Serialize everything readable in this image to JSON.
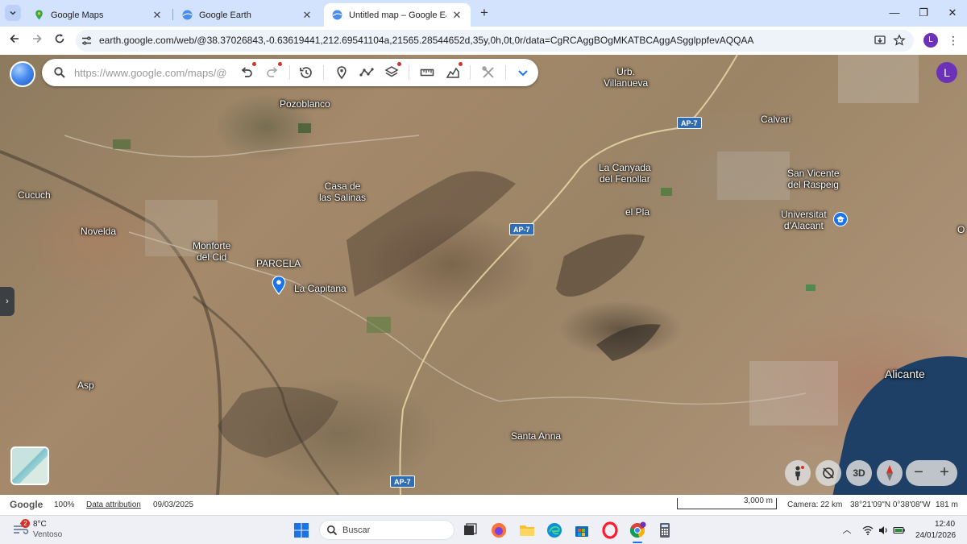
{
  "browser": {
    "tabs": [
      {
        "label": "Google Maps",
        "icon": "maps-pin-icon"
      },
      {
        "label": "Google Earth",
        "icon": "earth-icon"
      },
      {
        "label": "Untitled map – Google Earth",
        "icon": "earth-icon",
        "active": true
      }
    ],
    "url": "earth.google.com/web/@38.37026843,-0.63619441,212.69541104a,21565.28544652d,35y,0h,0t,0r/data=CgRCAggBOgMKATBCAggASgglppfevAQQAA",
    "profile_initial": "L"
  },
  "earth": {
    "search_placeholder": "https://www.google.com/maps/@",
    "user_initial": "L",
    "toolbar_icons": [
      "undo-icon",
      "redo-icon",
      "history-icon",
      "place-pin-icon",
      "path-icon",
      "layers-icon",
      "ruler-icon",
      "chart-icon",
      "tools-icon",
      "chevron-down-icon"
    ],
    "controls": {
      "three_d_label": "3D"
    },
    "places": {
      "pozoblanco": "Pozoblanco",
      "urb_villanueva_1": "Urb.",
      "urb_villanueva_2": "Villanueva",
      "calvari": "Calvari",
      "cucuch": "Cucuch",
      "casa_salinas_1": "Casa de",
      "casa_salinas_2": "las Salinas",
      "la_canyada_1": "La Canyada",
      "la_canyada_2": "del Fenollar",
      "san_vicente_1": "San Vicente",
      "san_vicente_2": "del Raspeig",
      "novelda": "Novelda",
      "el_pla": "el Pla",
      "universitat_1": "Universitat",
      "universitat_2": "d'Alacant",
      "monforte_1": "Monforte",
      "monforte_2": "del Cid",
      "parcela": "PARCELA",
      "la_capitana": "La Capitana",
      "asp": "Asp",
      "alicante": "Alicante",
      "santa_anna": "Santa Anna",
      "edge_o": "O"
    },
    "highway_label": "AP-7"
  },
  "status": {
    "brand": "Google",
    "zoom": "100%",
    "attribution": "Data attribution",
    "imagery_date": "09/03/2025",
    "scale": "3,000 m",
    "camera": "Camera: 22 km",
    "coords": "38°21'09\"N 0°38'08\"W",
    "elevation": "181 m"
  },
  "taskbar": {
    "weather_badge": "2",
    "temperature": "8°C",
    "weather_desc": "Ventoso",
    "search_label": "Buscar",
    "time": "12:40",
    "date": "24/01/2026"
  },
  "colors": {
    "accent": "#1a73e8",
    "tab_bar": "#d3e3fd",
    "profile": "#6b31b8",
    "highway_shield": "#2f6db5"
  }
}
